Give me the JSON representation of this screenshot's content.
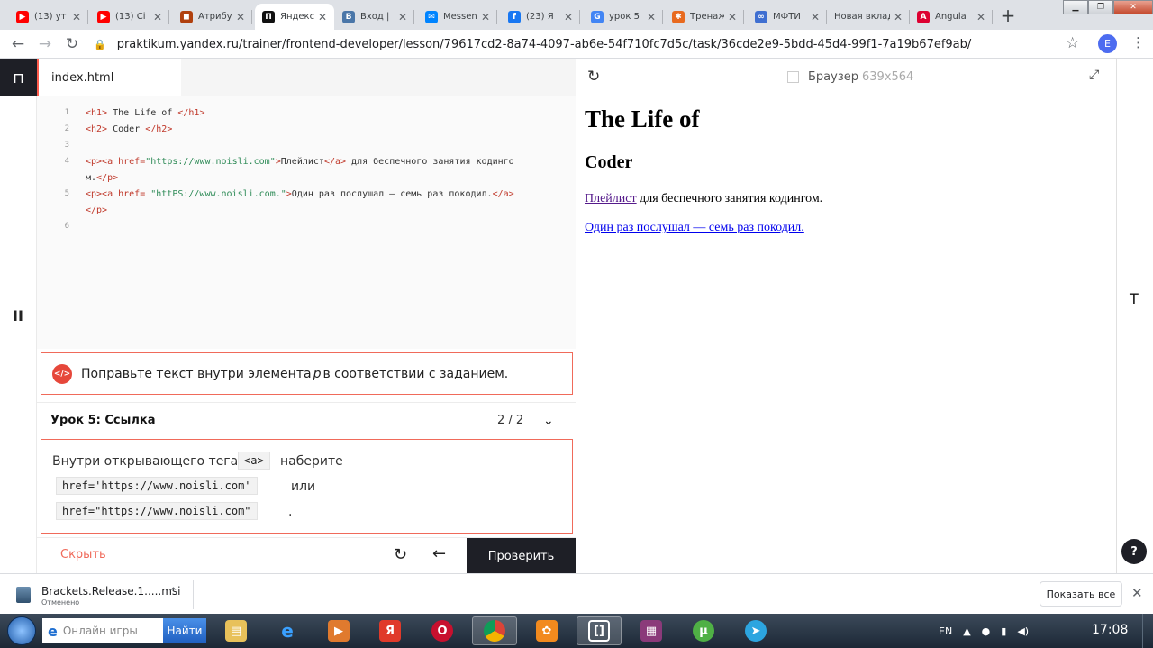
{
  "tabs": [
    {
      "title": "(13) ут",
      "icon": "youtube-icon",
      "color": "#ff0000",
      "glyph": "▶"
    },
    {
      "title": "(13) Ci",
      "icon": "youtube-icon",
      "color": "#ff0000",
      "glyph": "▶"
    },
    {
      "title": "Атрибут",
      "icon": "htmlacademy-icon",
      "color": "#b0400e",
      "glyph": "◼"
    },
    {
      "title": "Яндекс",
      "icon": "praktikum-icon",
      "color": "#111111",
      "glyph": "П",
      "active": true
    },
    {
      "title": "Вход |",
      "icon": "vk-icon",
      "color": "#4a76a8",
      "glyph": "В"
    },
    {
      "title": "Messen",
      "icon": "messenger-icon",
      "color": "#0084ff",
      "glyph": "✉"
    },
    {
      "title": "(23) Я",
      "icon": "facebook-icon",
      "color": "#1877f2",
      "glyph": "f"
    },
    {
      "title": "урок 5",
      "icon": "google-icon",
      "color": "#4285f4",
      "glyph": "G"
    },
    {
      "title": "Тренаж",
      "icon": "pinwheel-icon",
      "color": "#e86a1f",
      "glyph": "✱"
    },
    {
      "title": "МФТИ",
      "icon": "infinity-icon",
      "color": "#3f6fd1",
      "glyph": "∞"
    },
    {
      "title": "Новая вкладка",
      "icon": "",
      "color": "",
      "glyph": ""
    },
    {
      "title": "Angula",
      "icon": "angular-icon",
      "color": "#dd0031",
      "glyph": "A"
    }
  ],
  "address_bar": {
    "url": "praktikum.yandex.ru/trainer/frontend-developer/lesson/79617cd2-8a74-4097-ab6e-54f710fc7d5c/task/36cde2e9-5bdd-45d4-99f1-7a19b67ef9ab/"
  },
  "profile_initial": "E",
  "editor": {
    "filename": "index.html",
    "lines": [
      {
        "n": "1",
        "parts": [
          [
            "tag",
            "<h1>"
          ],
          [
            "txt",
            " The Life of "
          ],
          [
            "tag",
            "</h1>"
          ]
        ]
      },
      {
        "n": "2",
        "parts": [
          [
            "tag",
            "<h2>"
          ],
          [
            "txt",
            " Coder "
          ],
          [
            "tag",
            "</h2>"
          ]
        ]
      },
      {
        "n": "3",
        "parts": []
      },
      {
        "n": "4",
        "parts": [
          [
            "tag",
            "<p><a "
          ],
          [
            "attr",
            "href="
          ],
          [
            "str",
            "\"https://www.noisli.com\""
          ],
          [
            "tag",
            ">"
          ],
          [
            "txt",
            "Плейлист"
          ],
          [
            "tag",
            "</a>"
          ],
          [
            "txt",
            " для беспечного занятия кодинго"
          ]
        ]
      },
      {
        "n": "",
        "parts": [
          [
            "txt",
            "м."
          ],
          [
            "tag",
            "</p>"
          ]
        ]
      },
      {
        "n": "5",
        "parts": [
          [
            "tag",
            "<p><a "
          ],
          [
            "attr",
            "href= "
          ],
          [
            "str",
            "\"httPS://www.noisli.com.\""
          ],
          [
            "tag",
            ">"
          ],
          [
            "txt",
            "Один раз послушал — семь раз покодил."
          ],
          [
            "tag",
            "</a>"
          ]
        ]
      },
      {
        "n": "",
        "parts": [
          [
            "tag",
            "</p>"
          ]
        ]
      },
      {
        "n": "6",
        "parts": []
      }
    ]
  },
  "error_message": {
    "before": "Поправьте текст внутри элемента ",
    "em": "p",
    "after": " в соответствии с заданием."
  },
  "lesson": {
    "title": "Урок 5: Ссылка",
    "counter": "2 / 2"
  },
  "task": {
    "t1": "Внутри открывающего тега",
    "code1": "<a>",
    "t2": "наберите",
    "code2": "href='https://www.noisli.com'",
    "t3": "или",
    "code3": "href=\"https://www.noisli.com\"",
    "t4": "."
  },
  "bottom": {
    "hide": "Скрыть",
    "check": "Проверить"
  },
  "preview": {
    "label": "Браузер",
    "size": "639x564",
    "h1": "The Life of",
    "h2": "Coder",
    "p1_link": "Плейлист",
    "p1_rest": " для беспечного занятия кодингом.",
    "p2": "Один раз послушал — семь раз покодил."
  },
  "right_rail_letter": "T",
  "help": "?",
  "download": {
    "name": "Brackets.Release.1.....msi",
    "status": "Отменено",
    "show_all": "Показать все"
  },
  "taskbar": {
    "search_placeholder": "Онлайн игры",
    "search_button": "Найти",
    "lang": "EN",
    "time": "17:08"
  }
}
